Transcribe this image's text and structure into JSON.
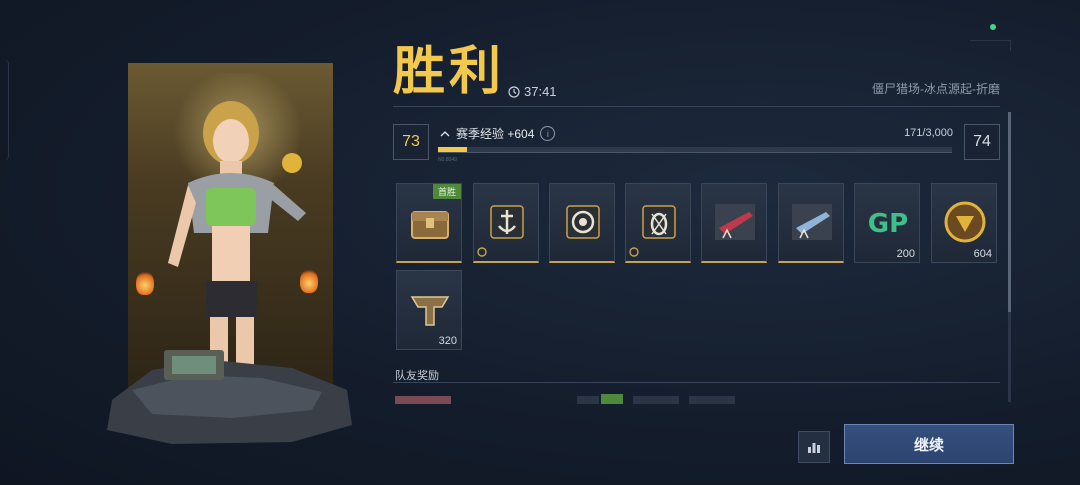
{
  "header": {
    "title": "胜利",
    "time": "37:41",
    "mode": "僵尸猎场-冰点源起-折磨"
  },
  "progress": {
    "current_level": "73",
    "next_level": "74",
    "exp_label": "赛季经验 +604",
    "exp_count": "171/3,000",
    "fill_fraction": 0.057,
    "tag": "N0.8049"
  },
  "rewards": [
    {
      "name": "chest",
      "badge": "首胜",
      "qty": ""
    },
    {
      "name": "anchor-emblem",
      "badge": "",
      "qty": ""
    },
    {
      "name": "target-emblem",
      "badge": "",
      "qty": ""
    },
    {
      "name": "bug-emblem",
      "badge": "",
      "qty": ""
    },
    {
      "name": "red-rifle-blueprint",
      "badge": "",
      "qty": ""
    },
    {
      "name": "blue-rifle-blueprint",
      "badge": "",
      "qty": ""
    },
    {
      "name": "gp-currency",
      "badge": "",
      "qty": "200"
    },
    {
      "name": "gold-coin",
      "badge": "",
      "qty": "604"
    },
    {
      "name": "tier-emblem",
      "badge": "",
      "qty": "320"
    }
  ],
  "team": {
    "label": "队友奖励"
  },
  "actions": {
    "continue_label": "继续"
  },
  "colors": {
    "accent_gold": "#f2c94c",
    "button_blue": "#35507e",
    "badge_green": "#4f8a3c"
  }
}
